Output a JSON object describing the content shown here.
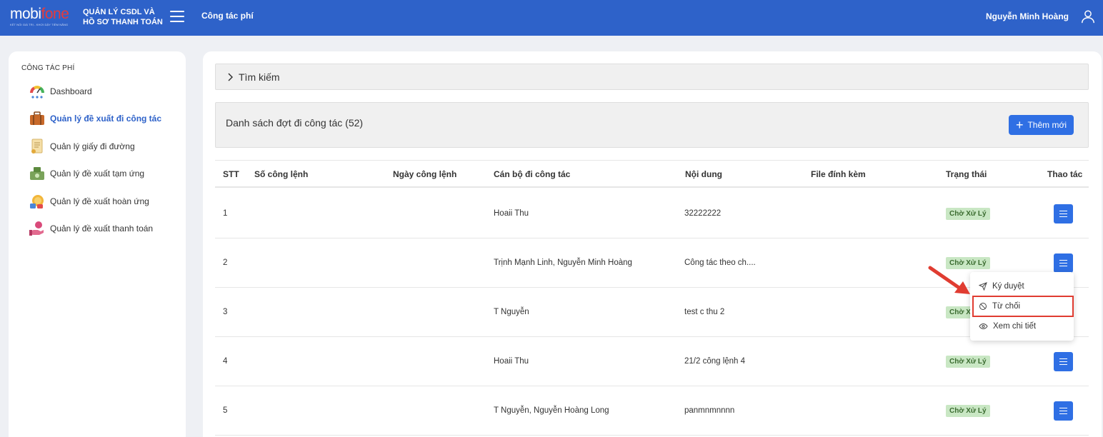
{
  "header": {
    "logo_main": "mobi",
    "logo_accent": "fone",
    "logo_tagline": "KẾT NỐI GIÁ TRỊ - KHƠI DẬY TIỀM NĂNG",
    "app_title": "QUẢN LÝ CSDL VÀ HỒ SƠ THANH TOÁN",
    "module": "Công tác phí",
    "user_name": "Nguyễn Minh Hoàng"
  },
  "sidebar": {
    "section_title": "CÔNG TÁC PHÍ",
    "items": [
      {
        "label": "Dashboard",
        "icon": "dashboard-gauge-icon",
        "active": false
      },
      {
        "label": "Quản lý đề xuất đi công tác",
        "icon": "briefcase-icon",
        "active": true
      },
      {
        "label": "Quản lý giấy đi đường",
        "icon": "document-scroll-icon",
        "active": false
      },
      {
        "label": "Quản lý đề xuất tạm ứng",
        "icon": "money-icon",
        "active": false
      },
      {
        "label": "Quản lý đề xuất hoàn ứng",
        "icon": "coin-refund-icon",
        "active": false
      },
      {
        "label": "Quản lý đề xuất thanh toán",
        "icon": "hand-coin-icon",
        "active": false
      }
    ]
  },
  "search": {
    "label": "Tìm kiếm"
  },
  "list": {
    "title": "Danh sách đợt đi công tác (52)",
    "add_label": "Thêm mới"
  },
  "table": {
    "columns": [
      "STT",
      "Số công lệnh",
      "Ngày công lệnh",
      "Cán bộ đi công tác",
      "Nội dung",
      "File đính kèm",
      "Trạng thái",
      "Thao tác"
    ],
    "rows": [
      {
        "stt": "1",
        "so_cong_lenh": "",
        "ngay_cong_lenh": "",
        "can_bo": "Hoaii Thu",
        "noi_dung": "32222222",
        "file": "",
        "trang_thai": "Chờ Xử Lý"
      },
      {
        "stt": "2",
        "so_cong_lenh": "",
        "ngay_cong_lenh": "",
        "can_bo": "Trịnh Mạnh Linh, Nguyễn Minh Hoàng",
        "noi_dung": "Công tác theo ch....",
        "file": "",
        "trang_thai": "Chờ Xử Lý"
      },
      {
        "stt": "3",
        "so_cong_lenh": "",
        "ngay_cong_lenh": "",
        "can_bo": "T Nguyễn",
        "noi_dung": "test c thu 2",
        "file": "",
        "trang_thai": "Chờ Xử Lý"
      },
      {
        "stt": "4",
        "so_cong_lenh": "",
        "ngay_cong_lenh": "",
        "can_bo": "Hoaii Thu",
        "noi_dung": "21/2 công lệnh 4",
        "file": "",
        "trang_thai": "Chờ Xử Lý"
      },
      {
        "stt": "5",
        "so_cong_lenh": "",
        "ngay_cong_lenh": "",
        "can_bo": "T Nguyễn, Nguyễn Hoàng Long",
        "noi_dung": "panmnmnnnn",
        "file": "",
        "trang_thai": "Chờ Xử Lý"
      }
    ]
  },
  "dropdown": {
    "items": [
      {
        "label": "Ký duyệt",
        "icon": "send-icon"
      },
      {
        "label": "Từ chối",
        "icon": "ban-icon"
      },
      {
        "label": "Xem chi tiết",
        "icon": "eye-icon"
      }
    ]
  },
  "colors": {
    "header_bg": "#2e62c9",
    "primary_button": "#2f6fe4",
    "status_badge_bg": "#c9e7c4",
    "annotation_red": "#e03c31"
  }
}
